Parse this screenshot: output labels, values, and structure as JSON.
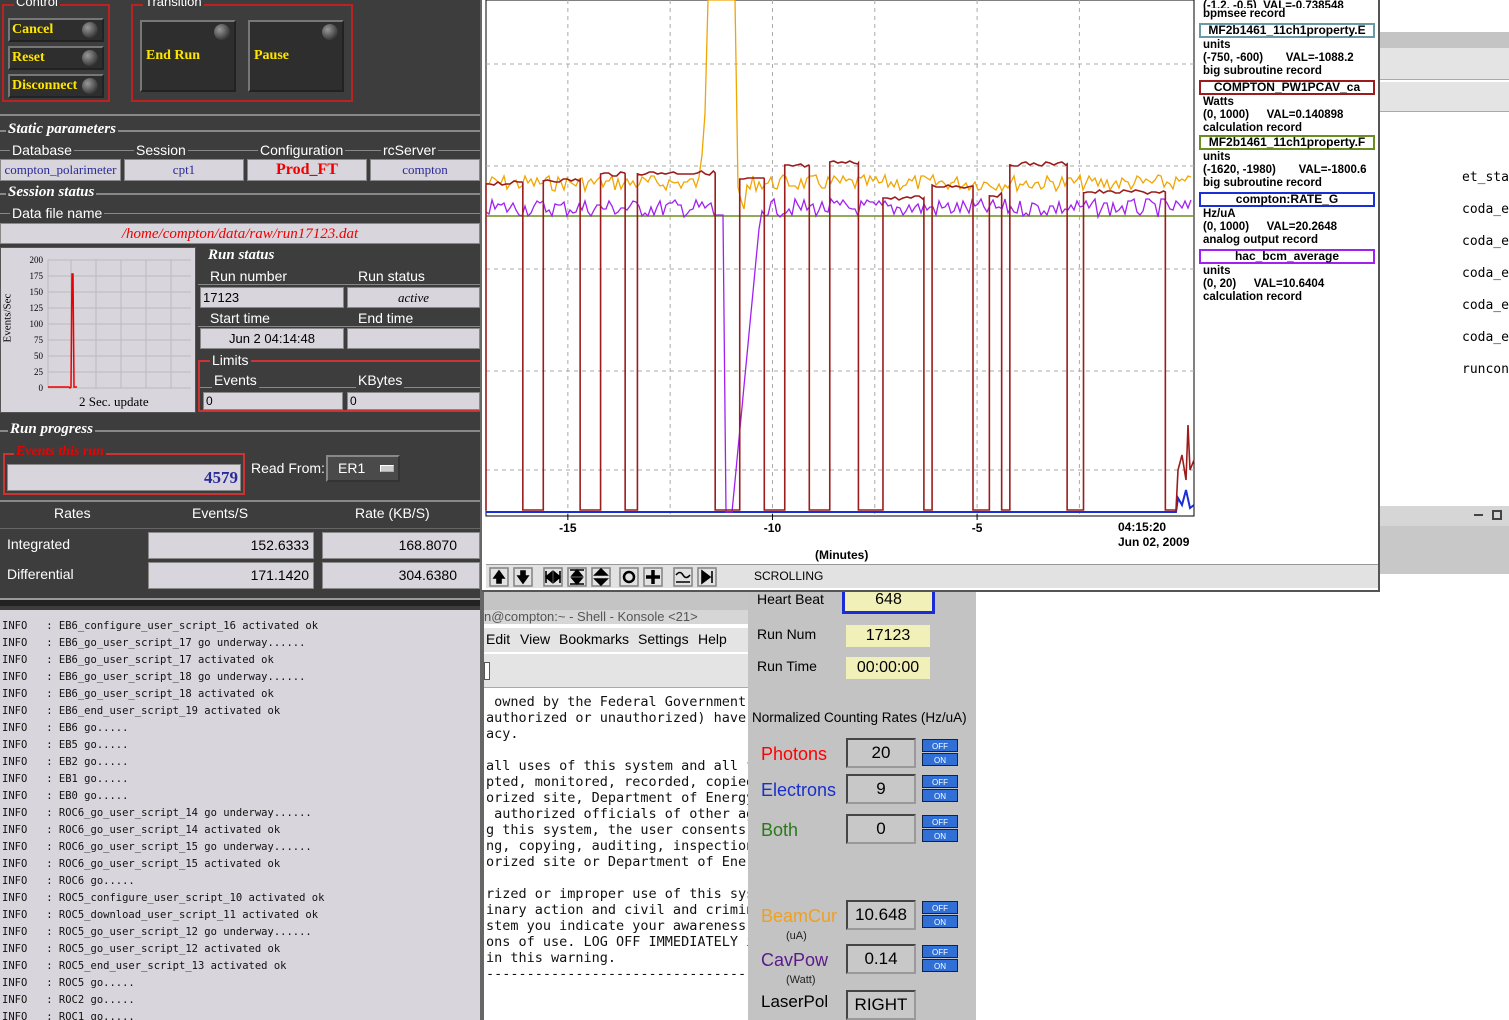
{
  "control": {
    "title": "Control",
    "buttons": [
      "Cancel",
      "Reset",
      "Disconnect"
    ],
    "transition_title": "Transition",
    "transition_buttons": [
      "End Run",
      "Pause"
    ]
  },
  "static_params": {
    "title": "Static parameters",
    "headers": [
      "Database",
      "Session",
      "Configuration",
      "rcServer"
    ],
    "values": [
      "compton_polarimeter",
      "cpt1",
      "Prod_FT",
      "compton"
    ]
  },
  "session_status": {
    "title": "Session status",
    "data_file_label": "Data file name",
    "data_file": "/home/compton/data/raw/run17123.dat"
  },
  "mini_chart": {
    "ylabel": "Events/Sec",
    "ticks": [
      "200",
      "175",
      "150",
      "125",
      "100",
      "75",
      "50",
      "25",
      "0"
    ],
    "caption": "2 Sec. update"
  },
  "run_status": {
    "title": "Run status",
    "run_number_label": "Run number",
    "run_number": "17123",
    "run_status_label": "Run status",
    "run_status": "active",
    "start_time_label": "Start time",
    "start_time": "Jun 2 04:14:48",
    "end_time_label": "End time",
    "end_time": "",
    "limits_label": "Limits",
    "events_label": "Events",
    "events": "0",
    "kbytes_label": "KBytes",
    "kbytes": "0"
  },
  "run_progress": {
    "title": "Run progress",
    "events_label": "Events this run",
    "events": "4579",
    "read_from_label": "Read From:",
    "read_from": "ER1"
  },
  "rates": {
    "headers": [
      "Rates",
      "Events/S",
      "Rate (KB/S)"
    ],
    "rows": [
      {
        "label": "Integrated",
        "events": "152.6333",
        "rate": "168.8070"
      },
      {
        "label": "Differential",
        "events": "171.1420",
        "rate": "304.6380"
      }
    ]
  },
  "log": [
    "INFO   : EB6_configure_user_script_16 activated ok",
    "INFO   : EB6_go_user_script_17 go underway......",
    "INFO   : EB6_go_user_script_17 activated ok",
    "INFO   : EB6_go_user_script_18 go underway......",
    "INFO   : EB6_go_user_script_18 activated ok",
    "INFO   : EB6_end_user_script_19 activated ok",
    "INFO   : EB6 go.....",
    "INFO   : EB5 go.....",
    "INFO   : EB2 go.....",
    "INFO   : EB1 go.....",
    "INFO   : EB0 go.....",
    "INFO   : ROC6_go_user_script_14 go underway......",
    "INFO   : ROC6_go_user_script_14 activated ok",
    "INFO   : ROC6_go_user_script_15 go underway......",
    "INFO   : ROC6_go_user_script_15 activated ok",
    "INFO   : ROC6 go.....",
    "INFO   : ROC5_configure_user_script_10 activated ok",
    "INFO   : ROC5_download_user_script_11 activated ok",
    "INFO   : ROC5_go_user_script_12 go underway......",
    "INFO   : ROC5_go_user_script_12 activated ok",
    "INFO   : ROC5_end_user_script_13 activated ok",
    "INFO   : ROC5 go.....",
    "INFO   : ROC2 go.....",
    "INFO   : ROC1 go....."
  ],
  "chart_data": {
    "type": "line",
    "xlabel": "(Minutes)",
    "x_ticks": [
      "-15",
      "-10",
      "-5"
    ],
    "x_end_label": "04:15:20",
    "x_end_date": "Jun 02, 2009",
    "xlim": [
      -17,
      0.3
    ],
    "series": [
      {
        "name": "COMPTON_PW1PCAV_ca",
        "color": "#9b1c1c",
        "units": "Watts",
        "range": "(0, 1000)",
        "val": "VAL=0.140898",
        "rtype": "calculation record",
        "segments_on": [
          [
            -17,
            -16.1
          ],
          [
            -15.6,
            -14.7
          ],
          [
            -14.2,
            -13.6
          ],
          [
            -13.3,
            -11.4
          ],
          [
            -10.8,
            -10.2
          ],
          [
            -9.7,
            -9.1
          ],
          [
            -8.6,
            -7.9
          ],
          [
            -7.3,
            -6.3
          ],
          [
            -6.1,
            -5.1
          ],
          [
            -4.7,
            -4.4
          ],
          [
            -4.2,
            -2.8
          ],
          [
            -2.4,
            -0.4
          ]
        ]
      },
      {
        "name": "MF2b1461_11ch1property.F",
        "color": "#6b8e23",
        "units": "units",
        "range": "(-1620, -1980)",
        "val": "VAL=-1800.6",
        "rtype": "big subroutine record",
        "level": 216
      },
      {
        "name": "compton:RATE_G",
        "color": "#1a2fd6",
        "units": "Hz/uA",
        "range": "(0, 1000)",
        "val": "VAL=20.2648",
        "rtype": "analog output record"
      },
      {
        "name": "hac_bcm_average",
        "color": "#a020f0",
        "units": "units",
        "range": "(0, 20)",
        "val": "VAL=10.6404",
        "rtype": "calculation record"
      },
      {
        "name": "MF2b1461_11ch1property.E",
        "color": "#6a9aa6",
        "units": "units",
        "range": "(-750, -600)",
        "val": "VAL=-1088.2",
        "rtype": "big subroutine record"
      }
    ],
    "legend_top_partial": "(-1.2, -0.5)  VAL=-0.738548",
    "legend_top_rtype": "bpmsee record",
    "toolbar_mode": "SCROLLING"
  },
  "terminal": {
    "title": "n@compton:~ - Shell - Konsole <21>",
    "menu": [
      "Edit",
      "View",
      "Bookmarks",
      "Settings",
      "Help"
    ],
    "lines": [
      " owned by the Federal Government.",
      "authorized or unauthorized) have",
      "acy.",
      "",
      "all uses of this system and all f",
      "pted, monitored, recorded, copied",
      "orized site, Department of Energy",
      " authorized officials of other ag",
      "g this system, the user consents",
      "ng, copying, auditing, inspection",
      "orized site or Department of Ener",
      "",
      "rized or improper use of this sys",
      "inary action and civil and crimin",
      "stem you indicate your awareness",
      "ons of use. LOG OFF IMMEDIATELY i",
      "in this warning.",
      "-----------------------------------"
    ]
  },
  "monitor": {
    "heart_beat_label": "Heart Beat",
    "heart_beat": "648",
    "run_num_label": "Run Num",
    "run_num": "17123",
    "run_time_label": "Run Time",
    "run_time": "00:00:00",
    "section_title": "Normalized Counting Rates (Hz/uA)",
    "rows": [
      {
        "label": "Photons",
        "value": "20",
        "color": "#ff0000",
        "sub": ""
      },
      {
        "label": "Electrons",
        "value": "9",
        "color": "#1a2fc9",
        "sub": ""
      },
      {
        "label": "Both",
        "value": "0",
        "color": "#2a7a1a",
        "sub": ""
      },
      {
        "label": "BeamCur",
        "value": "10.648",
        "color": "#f0a020",
        "sub": "(uA)"
      },
      {
        "label": "CavPow",
        "value": "0.14",
        "color": "#5a1a8a",
        "sub": "(Watt)"
      }
    ],
    "laserpol_label": "LaserPol",
    "laserpol": "RIGHT",
    "toggle_off": "OFF",
    "toggle_on": "ON"
  },
  "right_terminal": {
    "lines": [
      "et_sta",
      "coda_e",
      "coda_e",
      "coda_e",
      "coda_e",
      "coda_e",
      "runcon"
    ]
  }
}
